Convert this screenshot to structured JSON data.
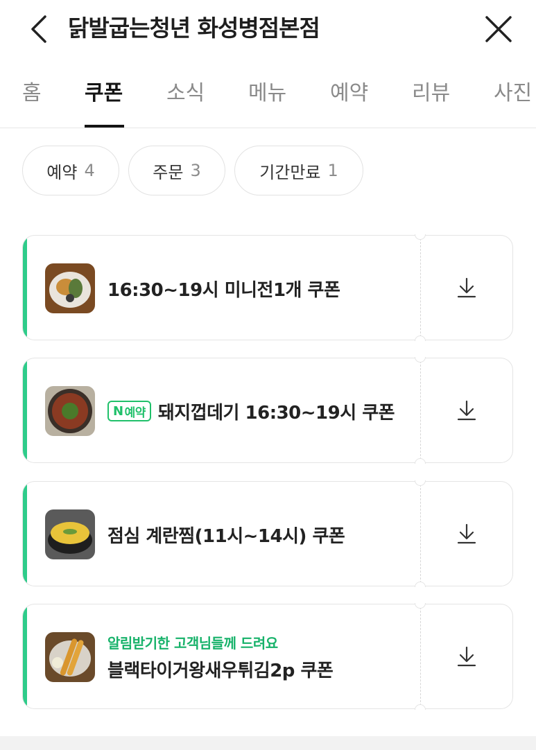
{
  "header": {
    "title": "닭발굽는청년 화성병점본점",
    "back_icon": "chevron-left-icon",
    "close_icon": "close-icon"
  },
  "tabs": [
    {
      "label": "홈",
      "active": false
    },
    {
      "label": "쿠폰",
      "active": true
    },
    {
      "label": "소식",
      "active": false
    },
    {
      "label": "메뉴",
      "active": false
    },
    {
      "label": "예약",
      "active": false
    },
    {
      "label": "리뷰",
      "active": false
    },
    {
      "label": "사진",
      "active": false
    }
  ],
  "filters": [
    {
      "label": "예약",
      "count": "4"
    },
    {
      "label": "주문",
      "count": "3"
    },
    {
      "label": "기간만료",
      "count": "1"
    }
  ],
  "coupons": [
    {
      "title": "16:30~19시 미니전1개 쿠폰",
      "badge": "",
      "note": "",
      "thumb": "mini-jeon"
    },
    {
      "title": "돼지껍데기 16:30~19시 쿠폰",
      "badge_mark": "N",
      "badge": "예약",
      "note": "",
      "thumb": "pork-skin"
    },
    {
      "title": "점심 계란찜(11시~14시) 쿠폰",
      "badge": "",
      "note": "",
      "thumb": "steamed-egg"
    },
    {
      "title": "블랙타이거왕새우튀김2p 쿠폰",
      "badge": "",
      "note": "알림받기한 고객님들께 드려요",
      "thumb": "fried-shrimp"
    }
  ],
  "download_icon": "download-icon",
  "colors": {
    "accent": "#2ecc8a",
    "note_green": "#17b26a",
    "badge_green": "#20c06a"
  }
}
